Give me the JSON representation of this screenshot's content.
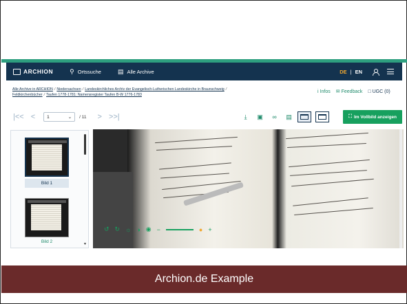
{
  "navbar": {
    "logo": "ARCHION",
    "search_label": "Ortssuche",
    "archives_label": "Alle Archive",
    "lang_de": "DE",
    "lang_sep": "|",
    "lang_en": "EN"
  },
  "breadcrumb": {
    "items": [
      "Alle Archive in ARCHION",
      "Niedersachsen",
      "Landeskirchliches Archiv der Evangelisch-Lutherischen Landeskirche in Braunschweig",
      "Feldkirchenbücher",
      "Taufen 1778-1781: Namensregister Taufen B-W 1776-1783"
    ],
    "separator": "/"
  },
  "aux_links": {
    "infos": "Infos",
    "feedback": "Feedback",
    "ugc": "UGC (0)"
  },
  "toolbar": {
    "first": "|<<",
    "prev": "<",
    "page_value": "1",
    "page_total": "/ 11",
    "next": ">",
    "last": ">>|",
    "fullscreen_label": "Im Vollbild anzeigen"
  },
  "thumbnails": [
    {
      "label": "Bild 1",
      "selected": true
    },
    {
      "label": "Bild 2",
      "selected": false
    }
  ],
  "caption": "Archion.de Example",
  "colors": {
    "navbar": "#14334f",
    "accent_green": "#17a05e",
    "lang_active": "#f0a830",
    "caption_bg": "#6a2a2a"
  }
}
